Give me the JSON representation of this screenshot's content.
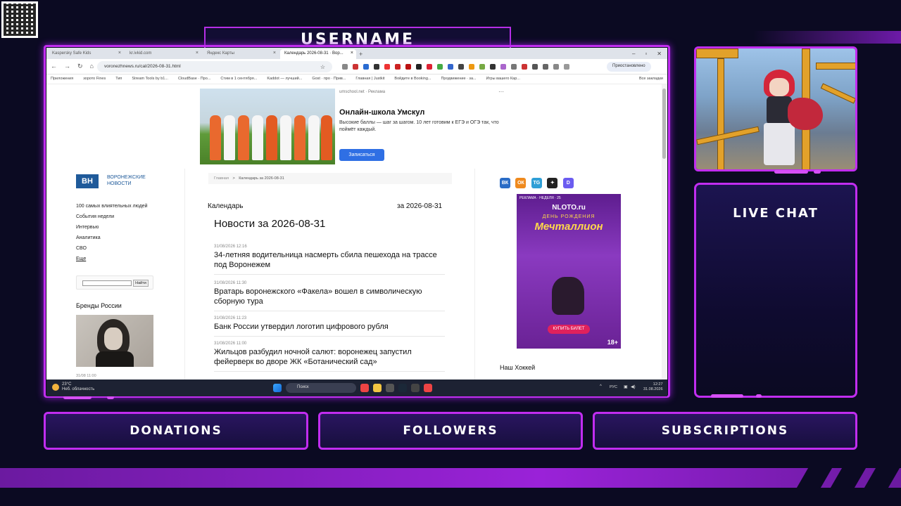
{
  "overlay": {
    "username": "USERNAME",
    "live_chat": "LIVE CHAT",
    "donations": "DONATIONS",
    "followers": "FOLLOWERS",
    "subscriptions": "SUBSCRIPTIONS"
  },
  "browser": {
    "tabs": [
      {
        "label": "Kaspersky Safe Kids"
      },
      {
        "label": "kr.ivkid.com"
      },
      {
        "label": "Яндекс Карты"
      },
      {
        "label": "Календарь 2026-08-31 · Вор..."
      }
    ],
    "url": "voronezhnews.ru/cal/2026-08-31.html",
    "profile_label": "Приостановлено",
    "bookmarks": [
      "Приложения",
      "зорото Fines",
      "Тип",
      "Stream Tools by b1...",
      "CloudBase · Про...",
      "Стим в 1 сентября...",
      "Kaddot — лучший...",
      "Gost · про · Прив...",
      "Главная | Justkit",
      "Войдите в Booking...",
      "Продвижение · за...",
      "Игры вашего Кар..."
    ],
    "bookmarks_right": "Все закладки"
  },
  "page": {
    "promo": {
      "source": "umschool.net · Реклама",
      "title": "Онлайн-школа Умскул",
      "text": "Высокие баллы — шаг за шагом. 10 лет готовим к ЕГЭ и ОГЭ так, что поймёт каждый.",
      "button": "Записаться",
      "more": "···"
    },
    "logo": {
      "mark": "ВН",
      "line1": "ВОРОНЕЖСКИЕ",
      "line2": "НОВОСТИ"
    },
    "side_links": [
      "100 самых влиятельных людей",
      "События недели",
      "Интервью",
      "Аналитика",
      "СВО",
      "Еще"
    ],
    "search_button": "Найти",
    "brands_title": "Бренды России",
    "side_bottom_date": "31/08 11:00",
    "breadcrumb_home": "Главная",
    "breadcrumb_sep": ">",
    "breadcrumb_current": "Календарь за 2026-08-31",
    "calendar_label": "Календарь",
    "calendar_date": "за 2026-08-31",
    "heading": "Новости за 2026-08-31",
    "news": [
      {
        "date": "31/08/2026 12:16",
        "title": "34-летняя водительница насмерть сбила пешехода на трассе под Воронежем"
      },
      {
        "date": "31/08/2026 11:30",
        "title": "Вратарь воронежского «Факела» вошел в символическую сборную тура"
      },
      {
        "date": "31/08/2026 11:23",
        "title": "Банк России утвердил логотип цифрового рубля"
      },
      {
        "date": "31/08/2026 11:00",
        "title": "Жильцов разбудил ночной салют: воронежец запустил фейерверк во дворе ЖК «Ботанический сад»"
      }
    ],
    "social": [
      "ВК",
      "ОК",
      "TG",
      "✦",
      "D"
    ],
    "ad": {
      "top": "РЕКЛАМА · НЕДЕЛЯ · 25",
      "brand": "NLOTO.ru",
      "line": "ДЕНЬ РОЖДЕНИЯ",
      "title": "Мечталлион",
      "button": "КУПИТЬ БИЛЕТ",
      "age": "18+"
    },
    "right_heading": "Наш Хоккей"
  },
  "taskbar": {
    "weather_temp": "23°C",
    "weather_text": "Неб. облачность",
    "search": "Поиск",
    "lang": "РУС",
    "time": "12:27",
    "date": "31.08.2026"
  }
}
